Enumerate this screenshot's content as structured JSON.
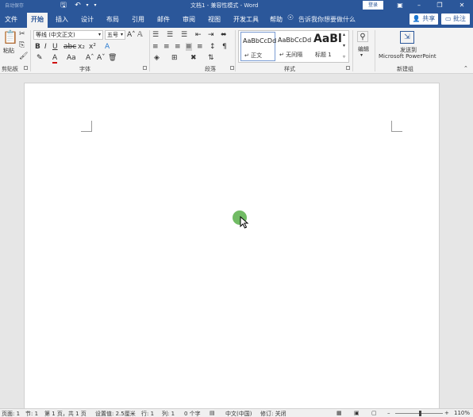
{
  "titlebar": {
    "autosave": "自动保存",
    "title": "文档1 - 兼容性模式 - Word",
    "login": "登录",
    "save_icon": "save-icon",
    "undo_icon": "undo-icon"
  },
  "tabs": [
    {
      "label": "文件"
    },
    {
      "label": "开始"
    },
    {
      "label": "插入"
    },
    {
      "label": "设计"
    },
    {
      "label": "布局"
    },
    {
      "label": "引用"
    },
    {
      "label": "邮件"
    },
    {
      "label": "审阅"
    },
    {
      "label": "视图"
    },
    {
      "label": "开发工具"
    },
    {
      "label": "帮助"
    }
  ],
  "tell_me": "告诉我你想要做什么",
  "share": "共享",
  "comment": "批注",
  "ribbon": {
    "clipboard": {
      "paste": "粘贴",
      "label": "剪贴板"
    },
    "font": {
      "name": "等线 (中文正文)",
      "size": "五号",
      "label": "字体"
    },
    "paragraph": {
      "label": "段落"
    },
    "styles": {
      "label": "样式",
      "items": [
        {
          "sample": "AaBbCcDd",
          "name": "↵ 正文"
        },
        {
          "sample": "AaBbCcDd",
          "name": "↵ 无间隔"
        },
        {
          "sample": "AaBl",
          "name": "标题 1"
        }
      ]
    },
    "editing": {
      "label": "编辑"
    },
    "newgroup": {
      "line1": "发送到",
      "line2": "Microsoft PowerPoint",
      "label": "新建组"
    }
  },
  "statusbar": {
    "page": "页面: 1",
    "section": "节: 1",
    "pageof": "第 1 页，共 1 页",
    "position": "设置值: 2.5厘米",
    "row": "行: 1",
    "col": "列: 1",
    "words": "0 个字",
    "lang": "中文(中国)",
    "track": "修订: 关闭",
    "zoom": "110%"
  }
}
